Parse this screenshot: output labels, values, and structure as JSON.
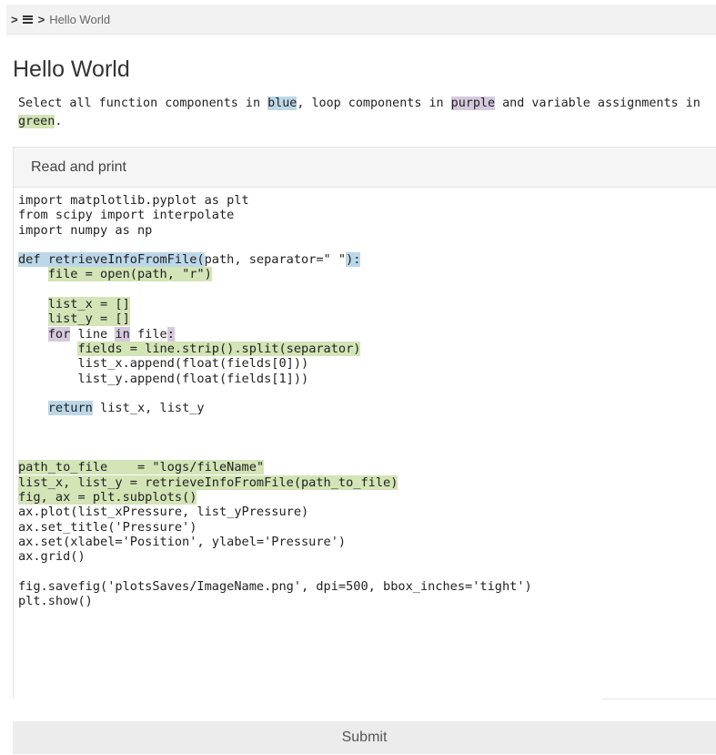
{
  "breadcrumb": {
    "separator": ">",
    "current": "Hello World"
  },
  "page": {
    "title": "Hello World",
    "instructions": {
      "p1": "Select all function components in ",
      "blue": "blue",
      "p2": ", loop components in ",
      "purple": "purple",
      "p3": " and variable assignments in ",
      "green": "green",
      "p4": "."
    }
  },
  "panel": {
    "title": "Read and print"
  },
  "colors": {
    "blue": "#bcd7e8",
    "purple": "#d6c9de",
    "green": "#d3e4b6"
  },
  "code": {
    "lines": [
      [
        {
          "t": "import matplotlib.pyplot as plt"
        }
      ],
      [
        {
          "t": "from scipy import interpolate"
        }
      ],
      [
        {
          "t": "import numpy as np"
        }
      ],
      [],
      [
        {
          "t": "def retrieveInfoFromFile(",
          "h": "blue"
        },
        {
          "t": "path, separator=\" \""
        },
        {
          "t": "):",
          "h": "blue"
        }
      ],
      [
        {
          "t": "    "
        },
        {
          "t": "file = open(path, \"r\")",
          "h": "green"
        }
      ],
      [],
      [
        {
          "t": "    "
        },
        {
          "t": "list_x = []",
          "h": "green"
        }
      ],
      [
        {
          "t": "    "
        },
        {
          "t": "list_y = []",
          "h": "green"
        }
      ],
      [
        {
          "t": "    "
        },
        {
          "t": "for",
          "h": "purple"
        },
        {
          "t": " line "
        },
        {
          "t": "in",
          "h": "purple"
        },
        {
          "t": " file"
        },
        {
          "t": ":",
          "h": "purple"
        }
      ],
      [
        {
          "t": "        "
        },
        {
          "t": "fields = line.strip().split(separator)",
          "h": "green"
        }
      ],
      [
        {
          "t": "        list_x.append(float(fields[0]))"
        }
      ],
      [
        {
          "t": "        list_y.append(float(fields[1]))"
        }
      ],
      [],
      [
        {
          "t": "    "
        },
        {
          "t": "return",
          "h": "blue"
        },
        {
          "t": " list_x, list_y"
        }
      ],
      [],
      [],
      [],
      [
        {
          "t": "path_to_file    = \"logs/fileName\"",
          "h": "green"
        }
      ],
      [
        {
          "t": "list_x, list_y = retrieveInfoFromFile(path_to_file)",
          "h": "green"
        }
      ],
      [
        {
          "t": "fig, ax = plt.subplots()",
          "h": "green"
        }
      ],
      [
        {
          "t": "ax.plot(list_xPressure, list_yPressure)"
        }
      ],
      [
        {
          "t": "ax.set_title('Pressure')"
        }
      ],
      [
        {
          "t": "ax.set(xlabel='Position', ylabel='Pressure')"
        }
      ],
      [
        {
          "t": "ax.grid()"
        }
      ],
      [],
      [
        {
          "t": "fig.savefig('plotsSaves/ImageName.png', dpi=500, bbox_inches='tight')"
        }
      ],
      [
        {
          "t": "plt.show()"
        }
      ]
    ]
  },
  "submit": {
    "label": "Submit"
  }
}
